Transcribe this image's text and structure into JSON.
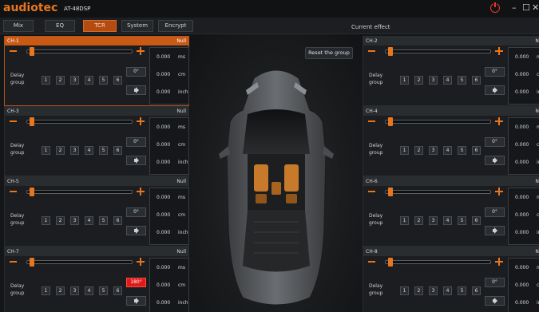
{
  "app": {
    "brand": "audiotec",
    "model": "AT-48DSP"
  },
  "window": {
    "minimize": "–",
    "maximize": "☐",
    "close": "✕"
  },
  "tabs": [
    {
      "label": "Mix",
      "active": false
    },
    {
      "label": "EQ",
      "active": false
    },
    {
      "label": "TCR",
      "active": true
    },
    {
      "label": "System",
      "active": false
    },
    {
      "label": "Encrypt",
      "active": false
    }
  ],
  "current_effect_label": "Current effect",
  "reset_button": "Reset the group",
  "delay_label": [
    "Delay",
    "group"
  ],
  "group_buttons": [
    "1",
    "2",
    "3",
    "4",
    "5",
    "6"
  ],
  "units": {
    "ms": "ms",
    "cm": "cm",
    "inch": "inch"
  },
  "accent_color": "#e8761e",
  "channels": [
    {
      "name": "CH-1",
      "mode": "Null",
      "phase": "0°",
      "phase_active": false,
      "ms": "0.000",
      "cm": "0.000",
      "inch": "0.000",
      "selected": true
    },
    {
      "name": "CH-2",
      "mode": "Null",
      "phase": "0°",
      "phase_active": false,
      "ms": "0.000",
      "cm": "0.000",
      "inch": "0.000",
      "selected": false
    },
    {
      "name": "CH-3",
      "mode": "Null",
      "phase": "0°",
      "phase_active": false,
      "ms": "0.000",
      "cm": "0.000",
      "inch": "0.000",
      "selected": false
    },
    {
      "name": "CH-4",
      "mode": "Null",
      "phase": "0°",
      "phase_active": false,
      "ms": "0.000",
      "cm": "0.000",
      "inch": "0.000",
      "selected": false
    },
    {
      "name": "CH-5",
      "mode": "Null",
      "phase": "0°",
      "phase_active": false,
      "ms": "0.000",
      "cm": "0.000",
      "inch": "0.000",
      "selected": false
    },
    {
      "name": "CH-6",
      "mode": "Null",
      "phase": "0°",
      "phase_active": false,
      "ms": "0.000",
      "cm": "0.000",
      "inch": "0.000",
      "selected": false
    },
    {
      "name": "CH-7",
      "mode": "Null",
      "phase": "180°",
      "phase_active": true,
      "ms": "0.000",
      "cm": "0.000",
      "inch": "0.000",
      "selected": false
    },
    {
      "name": "CH-8",
      "mode": "Null",
      "phase": "0°",
      "phase_active": false,
      "ms": "0.000",
      "cm": "0.000",
      "inch": "0.000",
      "selected": false
    }
  ]
}
